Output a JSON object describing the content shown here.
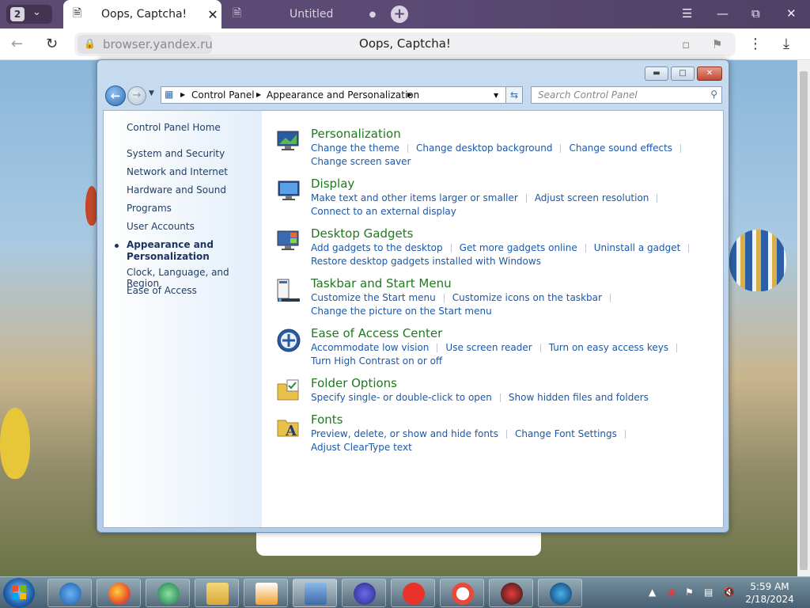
{
  "browser": {
    "tab_count": "2",
    "tabs": [
      {
        "label": "Oops, Captcha!",
        "active": true
      },
      {
        "label": "Untitled",
        "active": false
      }
    ],
    "url": "browser.yandex.ru",
    "page_title": "Oops, Captcha!"
  },
  "window": {
    "breadcrumb": [
      "Control Panel",
      "Appearance and Personalization"
    ],
    "search_placeholder": "Search Control Panel"
  },
  "sidebar": {
    "items": [
      {
        "label": "Control Panel Home"
      },
      {
        "label": "System and Security"
      },
      {
        "label": "Network and Internet"
      },
      {
        "label": "Hardware and Sound"
      },
      {
        "label": "Programs"
      },
      {
        "label": "User Accounts"
      },
      {
        "label": "Appearance and Personalization",
        "current": true
      },
      {
        "label": "Clock, Language, and Region"
      },
      {
        "label": "Ease of Access"
      }
    ]
  },
  "categories": [
    {
      "title": "Personalization",
      "links": [
        "Change the theme",
        "Change desktop background",
        "Change sound effects",
        "Change screen saver"
      ]
    },
    {
      "title": "Display",
      "links": [
        "Make text and other items larger or smaller",
        "Adjust screen resolution",
        "Connect to an external display"
      ]
    },
    {
      "title": "Desktop Gadgets",
      "links": [
        "Add gadgets to the desktop",
        "Get more gadgets online",
        "Uninstall a gadget",
        "Restore desktop gadgets installed with Windows"
      ]
    },
    {
      "title": "Taskbar and Start Menu",
      "links": [
        "Customize the Start menu",
        "Customize icons on the taskbar",
        "Change the picture on the Start menu"
      ]
    },
    {
      "title": "Ease of Access Center",
      "links": [
        "Accommodate low vision",
        "Use screen reader",
        "Turn on easy access keys",
        "Turn High Contrast on or off"
      ]
    },
    {
      "title": "Folder Options",
      "links": [
        "Specify single- or double-click to open",
        "Show hidden files and folders"
      ]
    },
    {
      "title": "Fonts",
      "links": [
        "Preview, delete, or show and hide fonts",
        "Change Font Settings",
        "Adjust ClearType text"
      ]
    }
  ],
  "taskbar": {
    "time": "5:59 AM",
    "date": "2/18/2024"
  }
}
